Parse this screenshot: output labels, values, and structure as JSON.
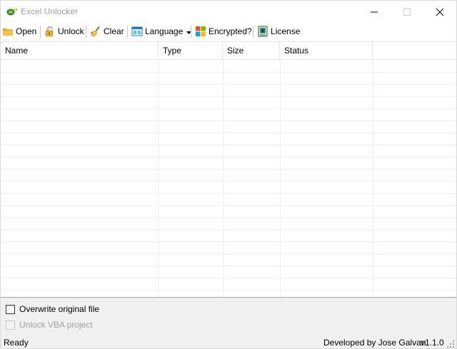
{
  "window": {
    "title": "Excel Unlocker"
  },
  "toolbar": {
    "open_label": "Open",
    "unlock_label": "Unlock",
    "clear_label": "Clear",
    "language_label": "Language",
    "encrypted_label": "Encrypted?",
    "license_label": "License"
  },
  "listview": {
    "columns": [
      "Name",
      "Type",
      "Size",
      "Status"
    ],
    "rows": []
  },
  "options": {
    "overwrite_label": "Overwrite original file",
    "overwrite_checked": false,
    "unlock_vba_label": "Unlock VBA project",
    "unlock_vba_checked": false
  },
  "statusbar": {
    "status_text": "Ready",
    "developer_text": "Developed by Jose Galvan",
    "version_text": "v1.1.0"
  },
  "icons": {
    "app": "excel-unlocker-app-icon",
    "open": "folder-icon",
    "unlock": "padlock-open-icon",
    "clear": "broom-icon",
    "language": "language-window-icon",
    "encrypted": "windows-logo-icon",
    "license": "license-certificate-icon"
  }
}
